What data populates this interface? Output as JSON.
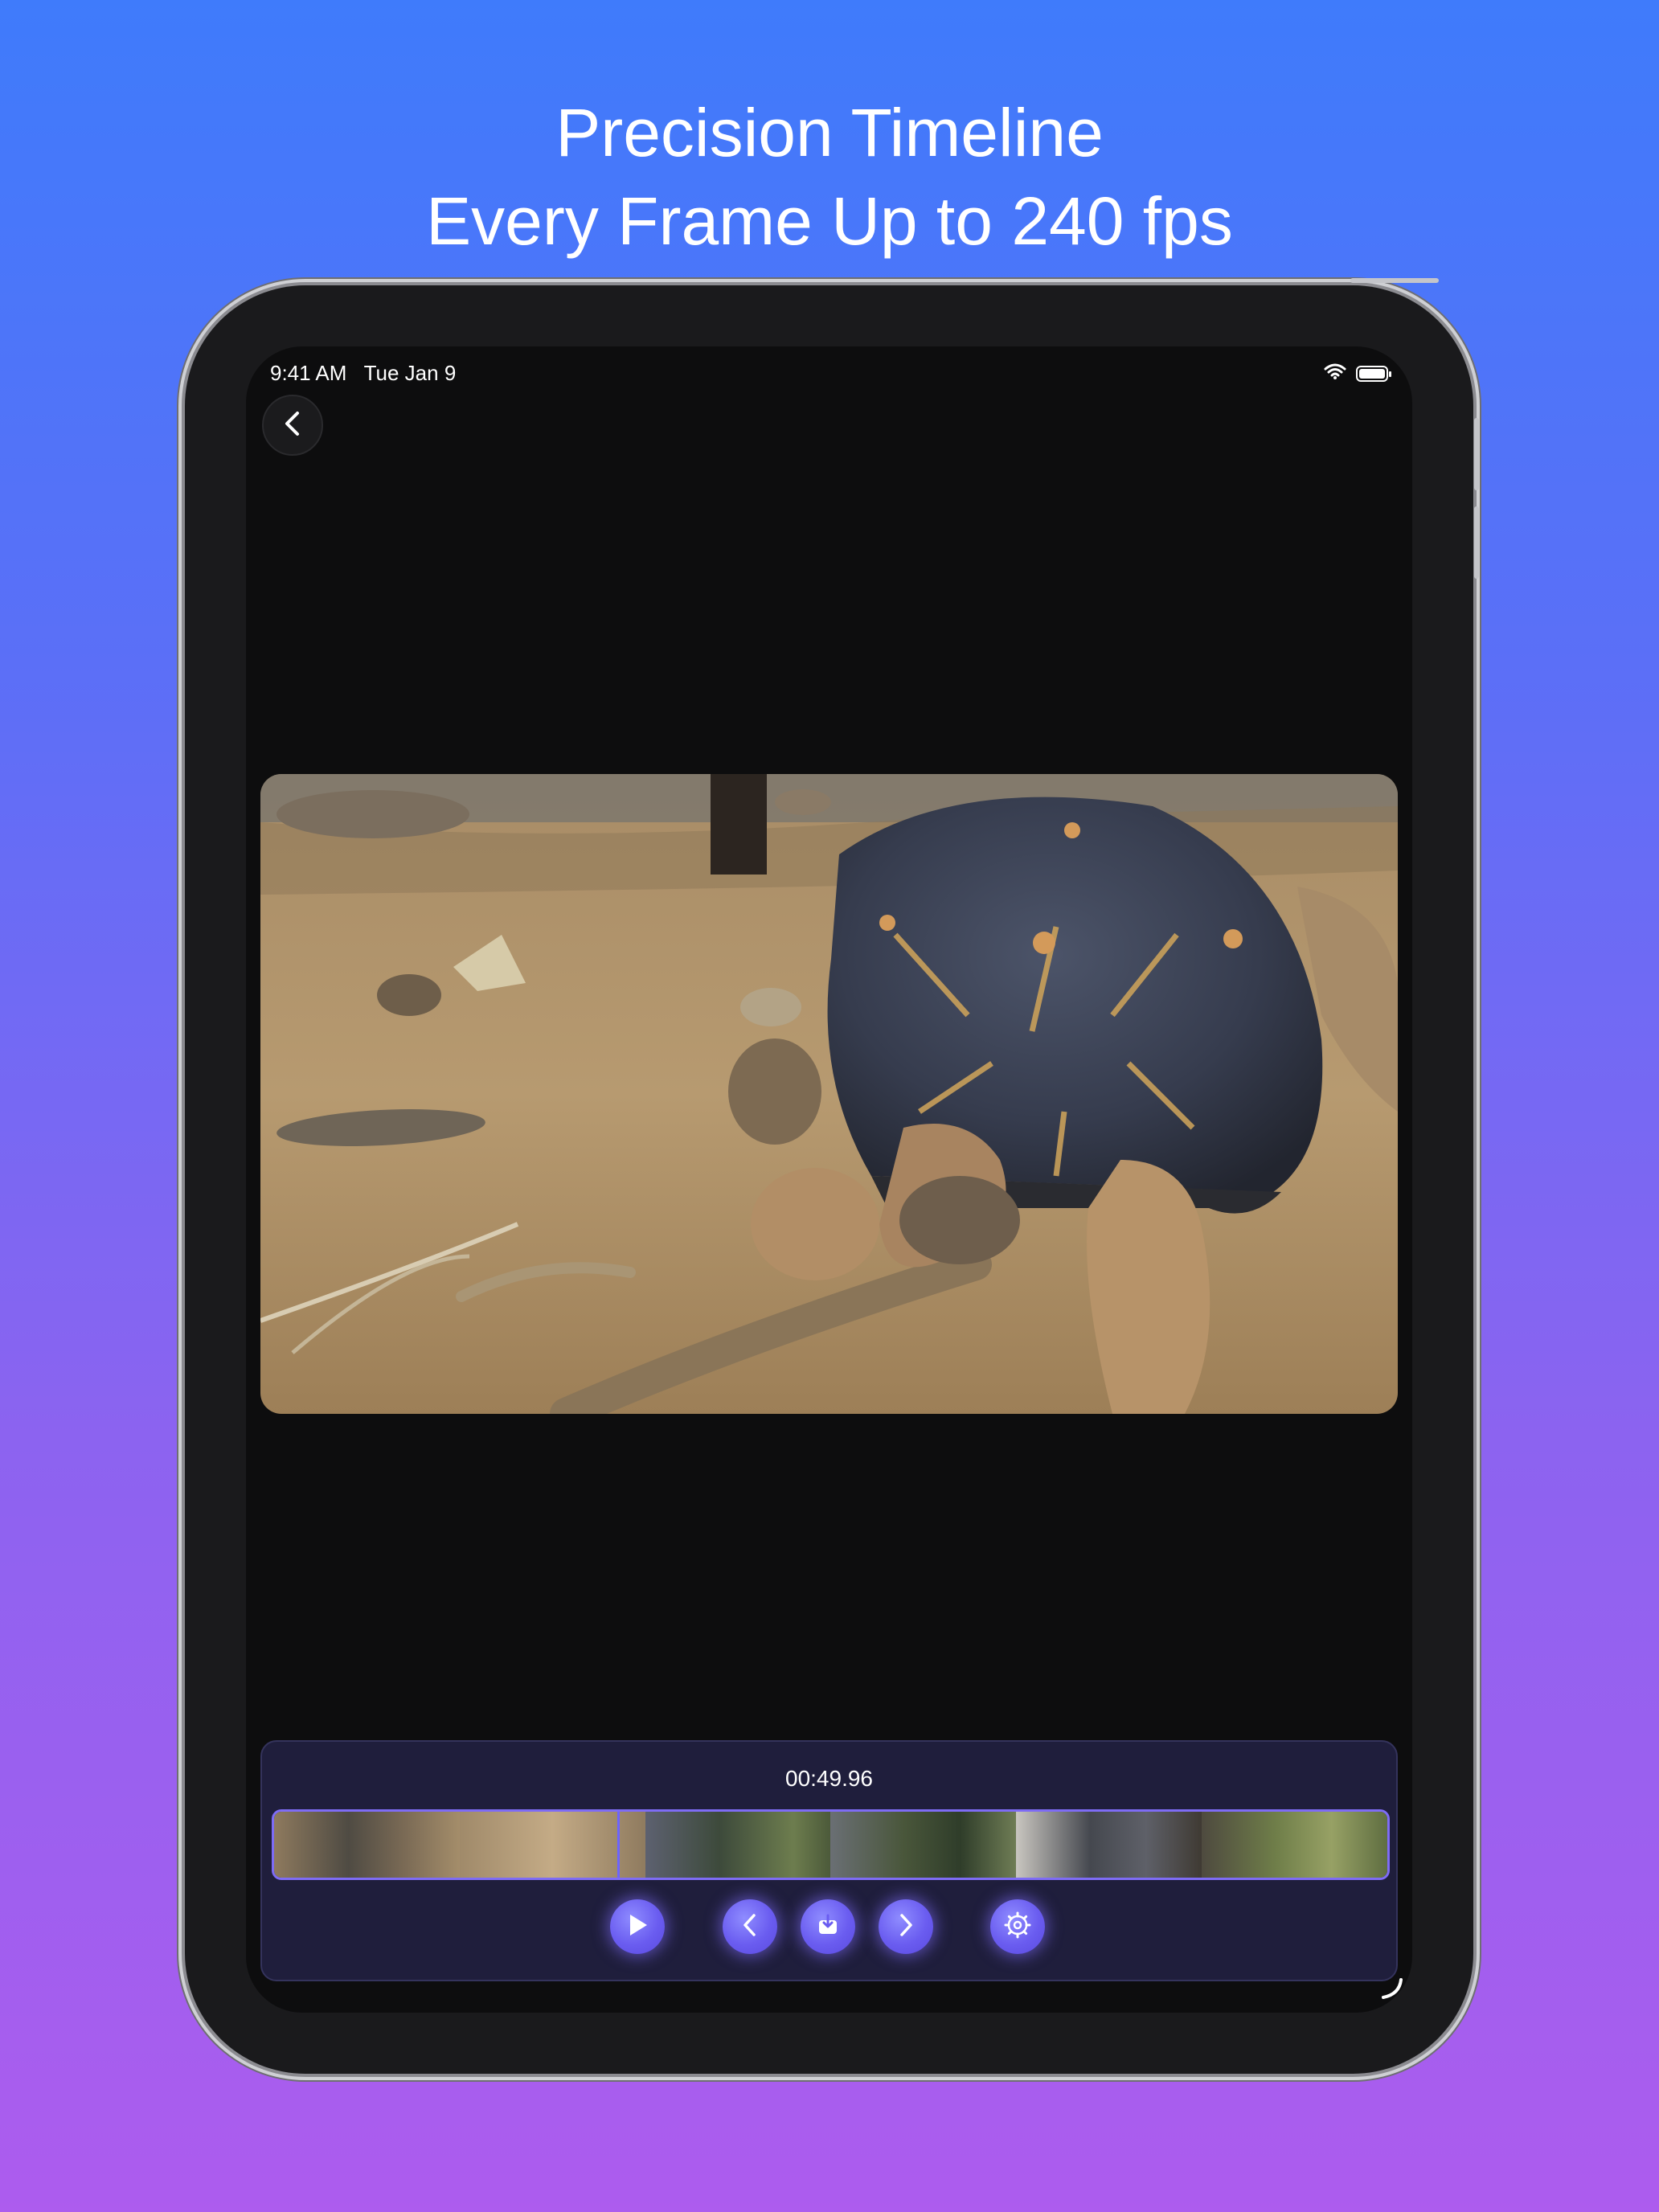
{
  "headline": {
    "line1": "Precision Timeline",
    "line2": "Every Frame Up to 240 fps"
  },
  "status_bar": {
    "time": "9:41 AM",
    "date": "Tue Jan 9"
  },
  "player": {
    "timecode": "00:49.96"
  },
  "colors": {
    "accent": "#7e6cf5",
    "panel": "#1f1e3c",
    "screen": "#0d0d0e"
  },
  "icons": {
    "back": "chevron-left-icon",
    "play": "play-icon",
    "previous_frame": "chevron-left-icon",
    "export_frame": "save-frame-icon",
    "next_frame": "chevron-right-icon",
    "settings": "gear-icon",
    "wifi": "wifi-icon",
    "battery": "battery-icon"
  }
}
